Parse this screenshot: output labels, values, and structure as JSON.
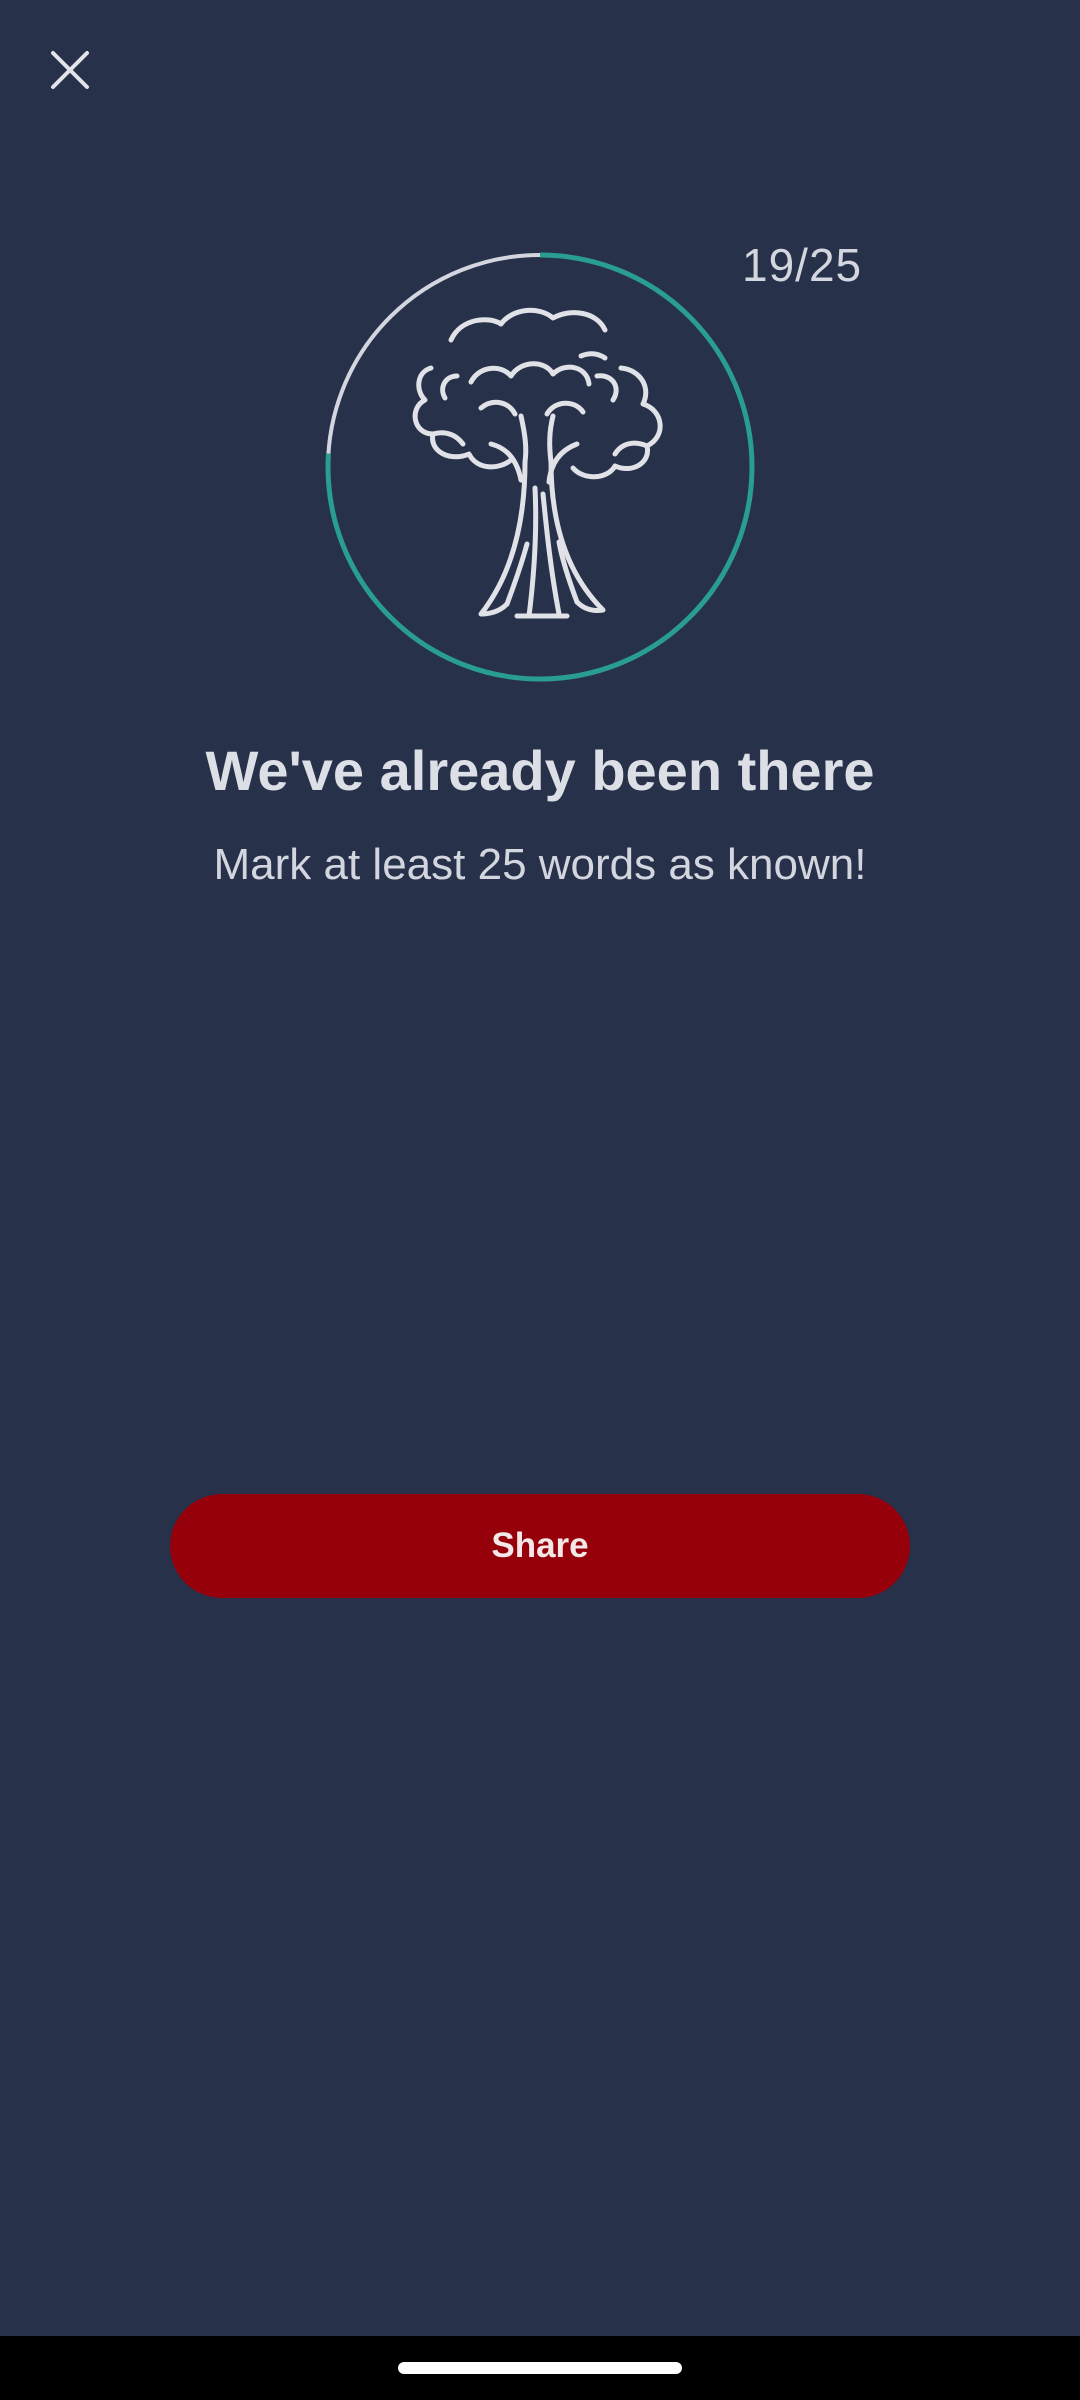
{
  "header": {
    "close_icon": "close-icon"
  },
  "progress": {
    "label": "19/25",
    "current": 19,
    "total": 25,
    "fraction": 0.76
  },
  "badge": {
    "icon": "tree-icon"
  },
  "content": {
    "title": "We've already been there",
    "subtitle": "Mark at least 25 words as known!"
  },
  "actions": {
    "share_label": "Share"
  },
  "colors": {
    "background": "#27314a",
    "progress_ring": "#2a9d91",
    "ring_track": "#d3d6df",
    "share_button": "#95000b"
  }
}
